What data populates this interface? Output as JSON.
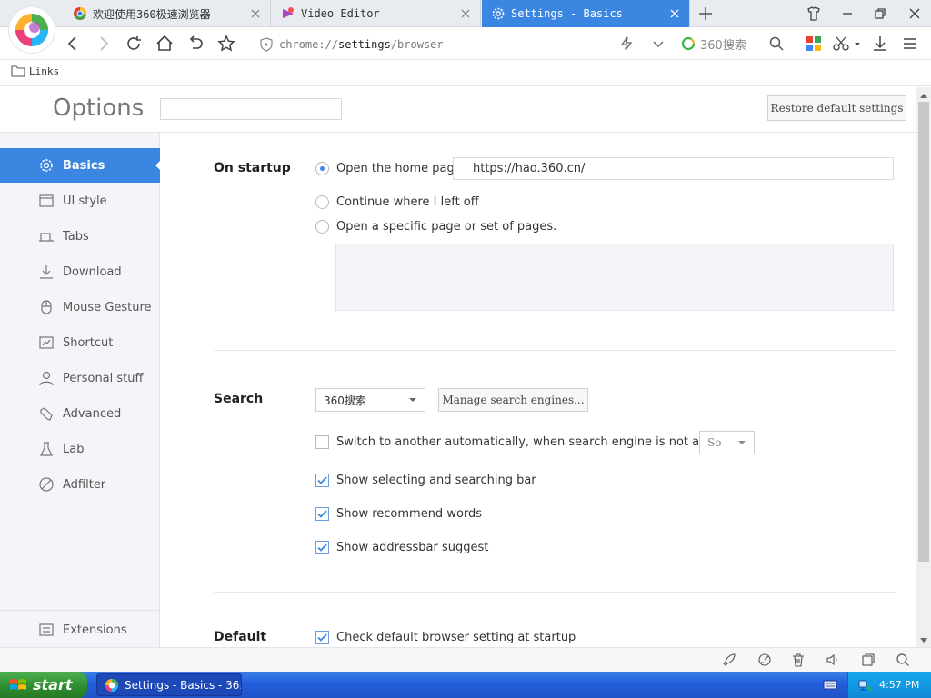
{
  "tabs": [
    {
      "label": "欢迎使用360极速浏览器",
      "active": false
    },
    {
      "label": "Video Editor",
      "active": false
    },
    {
      "label": "Settings - Basics",
      "active": true
    }
  ],
  "address": {
    "scheme": "chrome://",
    "host": "settings",
    "path": "/browser"
  },
  "search_engine_label": "360搜索",
  "bookmarks": [
    {
      "label": "Links"
    }
  ],
  "page": {
    "title": "Options",
    "restore_label": "Restore default settings"
  },
  "sidebar": {
    "items": [
      {
        "label": "Basics",
        "icon": "gear-icon",
        "active": true
      },
      {
        "label": "UI style",
        "icon": "window-icon"
      },
      {
        "label": "Tabs",
        "icon": "tab-icon"
      },
      {
        "label": "Download",
        "icon": "download-icon"
      },
      {
        "label": "Mouse Gesture",
        "icon": "mouse-icon"
      },
      {
        "label": "Shortcut",
        "icon": "shortcut-icon"
      },
      {
        "label": "Personal stuff",
        "icon": "person-icon"
      },
      {
        "label": "Advanced",
        "icon": "wrench-icon"
      },
      {
        "label": "Lab",
        "icon": "flask-icon"
      },
      {
        "label": "Adfilter",
        "icon": "block-icon"
      }
    ],
    "extensions_label": "Extensions"
  },
  "startup": {
    "title": "On startup",
    "home_label": "Open the home page",
    "home_url": "https://hao.360.cn/",
    "continue_label": "Continue where I left off",
    "specific_label": "Open a specific page or set of pages.",
    "selected": "home"
  },
  "search": {
    "title": "Search",
    "engine": "360搜索",
    "manage_label": "Manage search engines...",
    "switch_label": "Switch to another automatically, when search engine is not available",
    "switch_checked": false,
    "fallback_engine": "So",
    "selecting_bar_label": "Show selecting and searching bar",
    "selecting_bar_checked": true,
    "recommend_label": "Show recommend words",
    "recommend_checked": true,
    "addressbar_label": "Show addressbar suggest",
    "addressbar_checked": true
  },
  "default_browser": {
    "title": "Default",
    "check_label": "Check default browser setting at startup",
    "check_checked": true
  },
  "taskbar": {
    "start_label": "start",
    "task_label": "Settings - Basics - 36...",
    "clock": "4:57 PM"
  },
  "colors": {
    "accent": "#3b86e0",
    "taskbar": "#245edb",
    "start": "#2e8b2e"
  }
}
